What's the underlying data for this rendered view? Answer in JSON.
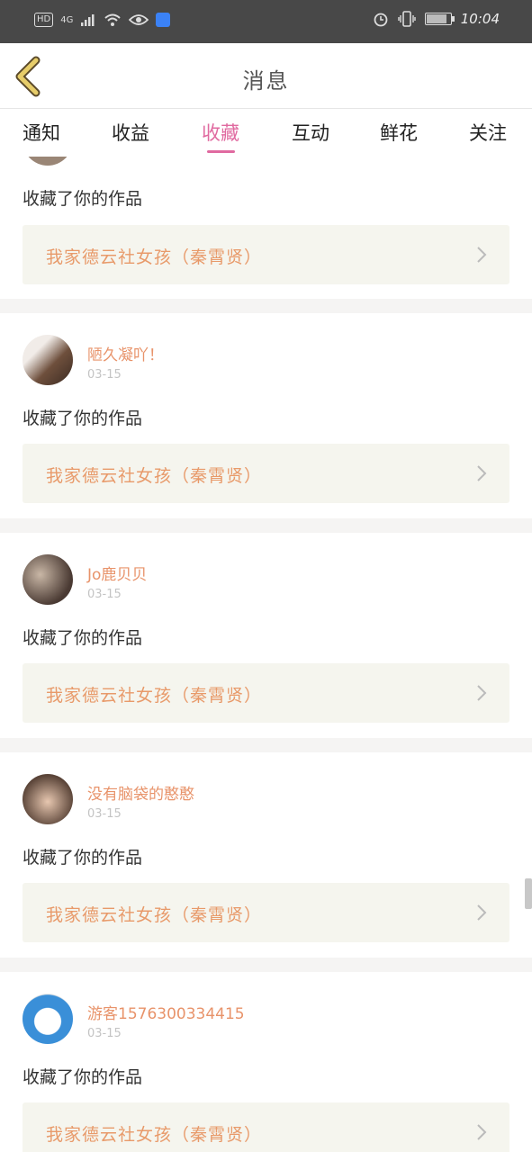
{
  "status_bar": {
    "hd": "HD",
    "network": "4G",
    "time": "10:04",
    "icons": [
      "signal-icon",
      "wifi-icon",
      "eye-icon",
      "app-icon",
      "alarm-icon",
      "vibrate-icon",
      "battery-icon"
    ]
  },
  "header": {
    "title": "消息",
    "back_icon": "chevron-left-icon"
  },
  "tabs": [
    {
      "label": "通知"
    },
    {
      "label": "收益"
    },
    {
      "label": "收藏",
      "active": true
    },
    {
      "label": "互动"
    },
    {
      "label": "鲜花"
    },
    {
      "label": "关注"
    }
  ],
  "colors": {
    "accent": "#e06aa0",
    "username": "#e8936a",
    "work_title": "#e89a6a",
    "work_bg": "#f5f5ee"
  },
  "items": [
    {
      "action": "收藏了你的作品",
      "work_title": "我家德云社女孩（秦霄贤）"
    },
    {
      "user": "陋久凝吖！",
      "date": "03-15",
      "action": "收藏了你的作品",
      "work_title": "我家德云社女孩（秦霄贤）"
    },
    {
      "user": "Jo鹿贝贝",
      "date": "03-15",
      "action": "收藏了你的作品",
      "work_title": "我家德云社女孩（秦霄贤）"
    },
    {
      "user": "没有脑袋的憨憨",
      "date": "03-15",
      "action": "收藏了你的作品",
      "work_title": "我家德云社女孩（秦霄贤）"
    },
    {
      "user": "游客1576300334415",
      "date": "03-15",
      "action": "收藏了你的作品",
      "work_title": "我家德云社女孩（秦霄贤）"
    }
  ]
}
